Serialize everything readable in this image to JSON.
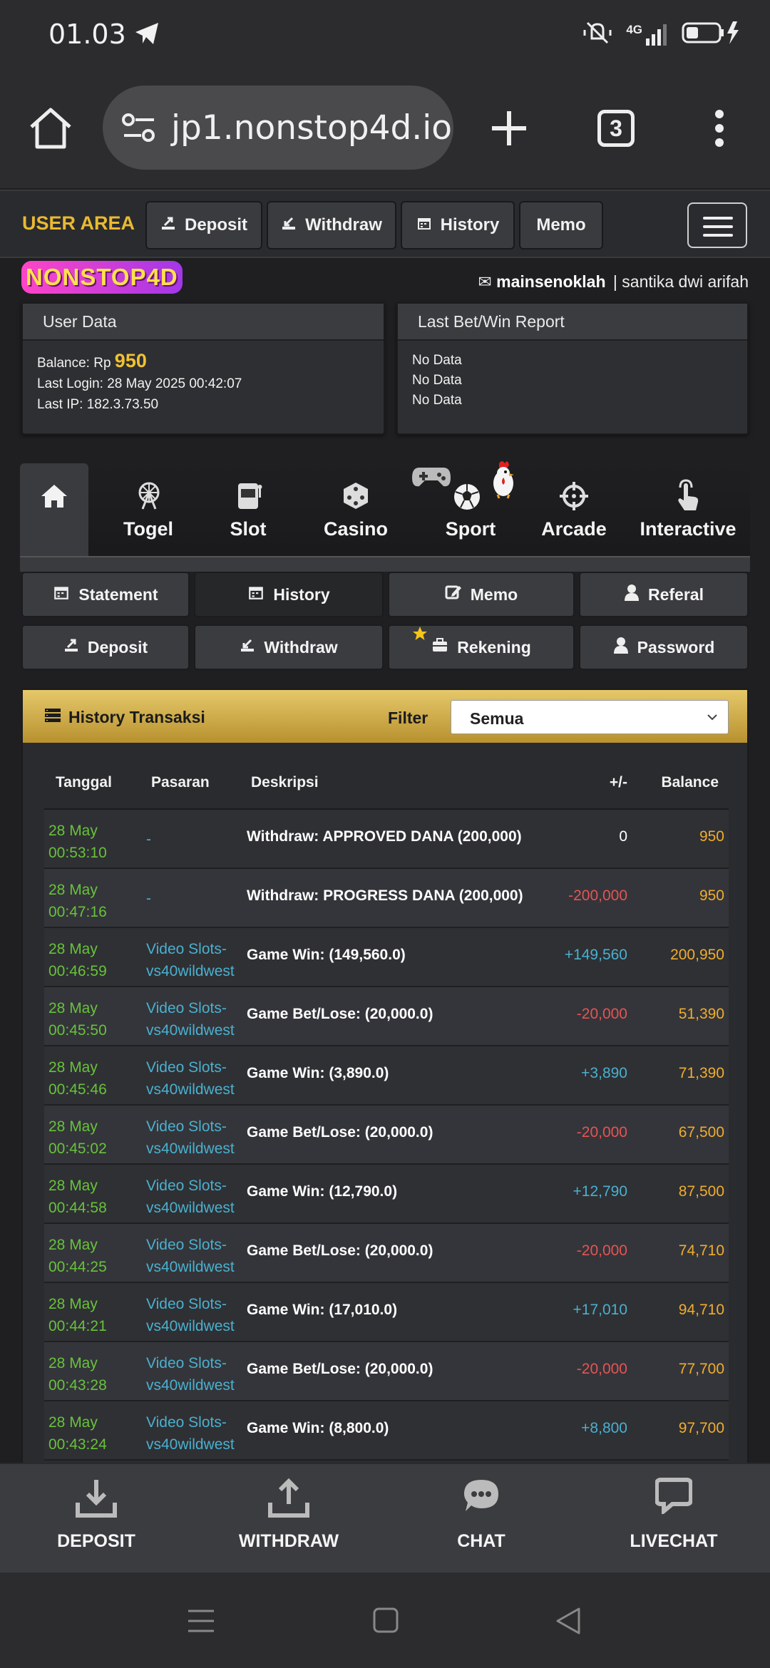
{
  "status_bar": {
    "time": "01.03",
    "network": "4G"
  },
  "browser": {
    "url": "jp1.nonstop4d.io",
    "tab_count": "3"
  },
  "header": {
    "user_area_label": "USER AREA",
    "buttons": {
      "deposit": "Deposit",
      "withdraw": "Withdraw",
      "history": "History",
      "memo": "Memo"
    }
  },
  "brand": {
    "logo_text": "NONSTOP4D"
  },
  "user": {
    "username": "mainsenoklah",
    "full_name": "santika dwi arifah"
  },
  "user_data": {
    "title": "User Data",
    "balance_label": "Balance: Rp",
    "balance_value": "950",
    "last_login": "Last Login: 28 May 2025 00:42:07",
    "last_ip": "Last IP: 182.3.73.50"
  },
  "last_bet": {
    "title": "Last Bet/Win Report",
    "lines": [
      "No Data",
      "No Data",
      "No Data"
    ]
  },
  "games": {
    "togel": "Togel",
    "slot": "Slot",
    "casino": "Casino",
    "sport": "Sport",
    "arcade": "Arcade",
    "interactive": "Interactive"
  },
  "subnav": {
    "statement": "Statement",
    "history": "History",
    "memo": "Memo",
    "referal": "Referal",
    "deposit": "Deposit",
    "withdraw": "Withdraw",
    "rekening": "Rekening",
    "password": "Password"
  },
  "history": {
    "title": "History Transaksi",
    "filter_label": "Filter",
    "filter_value": "Semua",
    "columns": {
      "date": "Tanggal",
      "market": "Pasaran",
      "desc": "Deskripsi",
      "change": "+/-",
      "balance": "Balance"
    },
    "rows": [
      {
        "date": "28 May",
        "time": "00:53:10",
        "market1": "-",
        "market2": "",
        "desc": "Withdraw: APPROVED DANA (200,000)",
        "change": "0",
        "sign": "zero",
        "balance": "950"
      },
      {
        "date": "28 May",
        "time": "00:47:16",
        "market1": "-",
        "market2": "",
        "desc": "Withdraw: PROGRESS DANA (200,000)",
        "change": "-200,000",
        "sign": "neg",
        "balance": "950"
      },
      {
        "date": "28 May",
        "time": "00:46:59",
        "market1": "Video Slots-",
        "market2": "vs40wildwest",
        "desc": "Game Win: (149,560.0)",
        "change": "+149,560",
        "sign": "pos",
        "balance": "200,950"
      },
      {
        "date": "28 May",
        "time": "00:45:50",
        "market1": "Video Slots-",
        "market2": "vs40wildwest",
        "desc": "Game Bet/Lose: (20,000.0)",
        "change": "-20,000",
        "sign": "neg",
        "balance": "51,390"
      },
      {
        "date": "28 May",
        "time": "00:45:46",
        "market1": "Video Slots-",
        "market2": "vs40wildwest",
        "desc": "Game Win: (3,890.0)",
        "change": "+3,890",
        "sign": "pos",
        "balance": "71,390"
      },
      {
        "date": "28 May",
        "time": "00:45:02",
        "market1": "Video Slots-",
        "market2": "vs40wildwest",
        "desc": "Game Bet/Lose: (20,000.0)",
        "change": "-20,000",
        "sign": "neg",
        "balance": "67,500"
      },
      {
        "date": "28 May",
        "time": "00:44:58",
        "market1": "Video Slots-",
        "market2": "vs40wildwest",
        "desc": "Game Win: (12,790.0)",
        "change": "+12,790",
        "sign": "pos",
        "balance": "87,500"
      },
      {
        "date": "28 May",
        "time": "00:44:25",
        "market1": "Video Slots-",
        "market2": "vs40wildwest",
        "desc": "Game Bet/Lose: (20,000.0)",
        "change": "-20,000",
        "sign": "neg",
        "balance": "74,710"
      },
      {
        "date": "28 May",
        "time": "00:44:21",
        "market1": "Video Slots-",
        "market2": "vs40wildwest",
        "desc": "Game Win: (17,010.0)",
        "change": "+17,010",
        "sign": "pos",
        "balance": "94,710"
      },
      {
        "date": "28 May",
        "time": "00:43:28",
        "market1": "Video Slots-",
        "market2": "vs40wildwest",
        "desc": "Game Bet/Lose: (20,000.0)",
        "change": "-20,000",
        "sign": "neg",
        "balance": "77,700"
      },
      {
        "date": "28 May",
        "time": "00:43:24",
        "market1": "Video Slots-",
        "market2": "vs40wildwest",
        "desc": "Game Win: (8,800.0)",
        "change": "+8,800",
        "sign": "pos",
        "balance": "97,700"
      }
    ]
  },
  "bottom_bar": {
    "deposit": "DEPOSIT",
    "withdraw": "WITHDRAW",
    "chat": "CHAT",
    "livechat": "LIVECHAT"
  },
  "colors": {
    "accent_gold": "#e9b931",
    "positive": "#4ab0cf",
    "negative": "#e55454",
    "date_green": "#67c23a",
    "balance_orange": "#f0ad2e"
  }
}
